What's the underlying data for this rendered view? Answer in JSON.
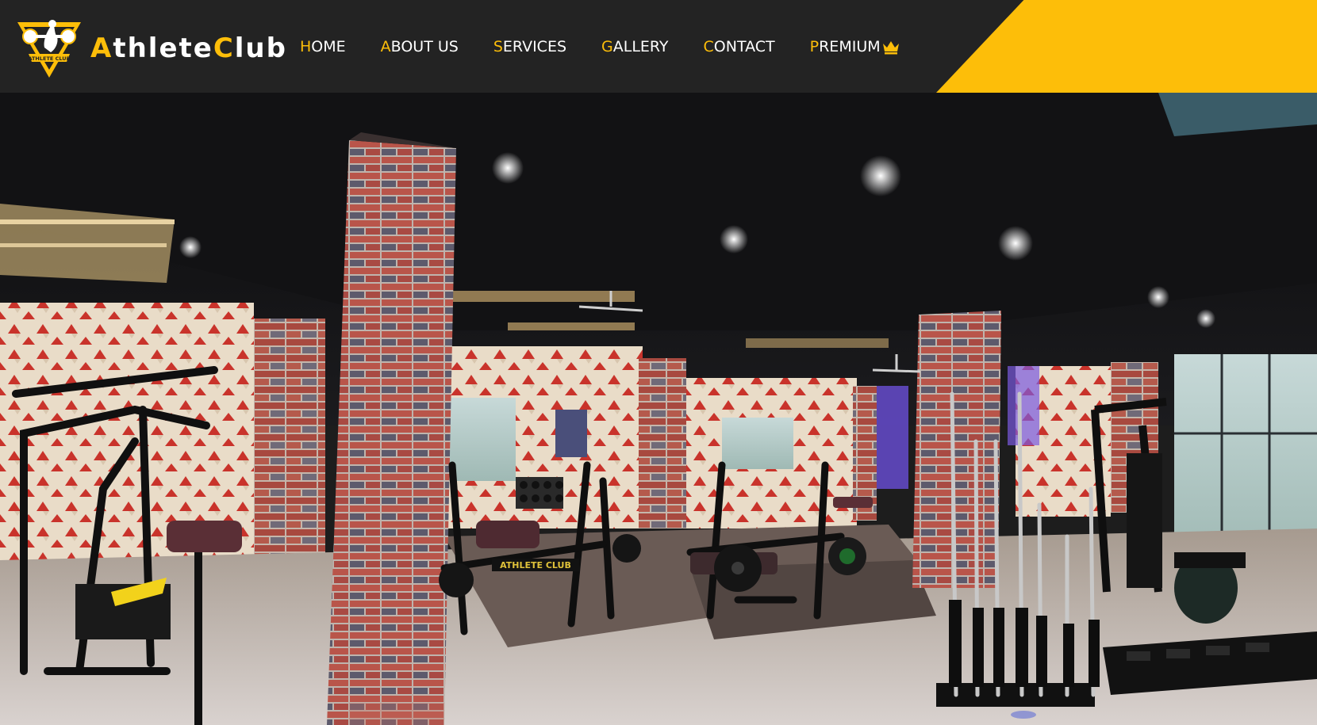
{
  "site": {
    "brand_first": "A",
    "brand_middle": "thlete",
    "brand_club_first": "C",
    "brand_club_rest": "lub",
    "emblem_text": "ATHLETE CLUB"
  },
  "nav": {
    "items": [
      {
        "initial": "H",
        "rest": "OME"
      },
      {
        "initial": "A",
        "rest": "BOUT US"
      },
      {
        "initial": "S",
        "rest": "ERVICES"
      },
      {
        "initial": "G",
        "rest": "ALLERY"
      },
      {
        "initial": "C",
        "rest": "ONTACT"
      },
      {
        "initial": "P",
        "rest": "REMIUM"
      }
    ],
    "premium_icon": "crown-icon"
  },
  "hero": {
    "equipment_label": "ATHLETE CLUB"
  },
  "colors": {
    "accent": "#FDBE09",
    "header_bg": "#232323",
    "nav_text": "#ffffff"
  }
}
